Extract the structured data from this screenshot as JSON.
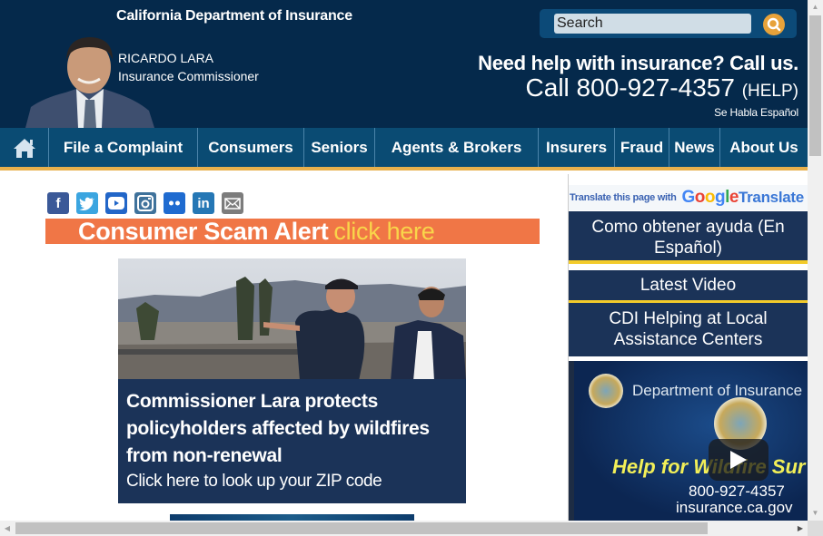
{
  "header": {
    "agency": "California Department of Insurance",
    "commissioner_name": "RICARDO LARA",
    "commissioner_title": "Insurance Commissioner",
    "search": {
      "placeholder": "Search",
      "icon": "search-icon"
    },
    "help_line": "Need help with insurance? Call us.",
    "call_prefix": "Call 800-927-4357",
    "call_suffix": "(HELP)",
    "espanol": "Se Habla Español"
  },
  "nav": {
    "home_icon": "home-icon",
    "items": [
      {
        "label": "File a Complaint"
      },
      {
        "label": "Consumers"
      },
      {
        "label": "Seniors"
      },
      {
        "label": "Agents & Brokers"
      },
      {
        "label": "Insurers"
      },
      {
        "label": "Fraud"
      },
      {
        "label": "News"
      },
      {
        "label": "About Us"
      }
    ],
    "colors": {
      "background": "#0a4b73",
      "underline": "#e8b04c"
    }
  },
  "social": [
    {
      "name": "facebook",
      "glyph": "f",
      "color": "#3b5998"
    },
    {
      "name": "twitter",
      "glyph": "t",
      "color": "#3ba5e0"
    },
    {
      "name": "youtube",
      "glyph": "▶",
      "color": "#2266c8"
    },
    {
      "name": "instagram",
      "glyph": "◘",
      "color": "#3f729b"
    },
    {
      "name": "flickr",
      "glyph": "••",
      "color": "#1f6bd0"
    },
    {
      "name": "linkedin",
      "glyph": "in",
      "color": "#2577b5"
    },
    {
      "name": "email",
      "glyph": "✉",
      "color": "#7c7c7c"
    }
  ],
  "scam_banner": {
    "text": "Consumer Scam Alert",
    "link": "click here",
    "color": "#f07646"
  },
  "feature": {
    "headline": "Commissioner Lara protects policyholders affected by wildfires from non-renewal",
    "subline": "Click here to look up your ZIP code"
  },
  "sidebar": {
    "translate_prefix": "Translate this page with",
    "google": [
      "G",
      "o",
      "o",
      "g",
      "l",
      "e"
    ],
    "translate_word": "Translate",
    "buttons": [
      {
        "label": "Como obtener ayuda (En Español)"
      },
      {
        "label": "Latest Video"
      },
      {
        "label": "CDI Helping at Local Assistance Centers"
      }
    ],
    "video": {
      "title": "Department of Insurance",
      "headline": "Help for Wildfire Sur",
      "phone": "800-927-4357",
      "url": "insurance.ca.gov"
    }
  }
}
